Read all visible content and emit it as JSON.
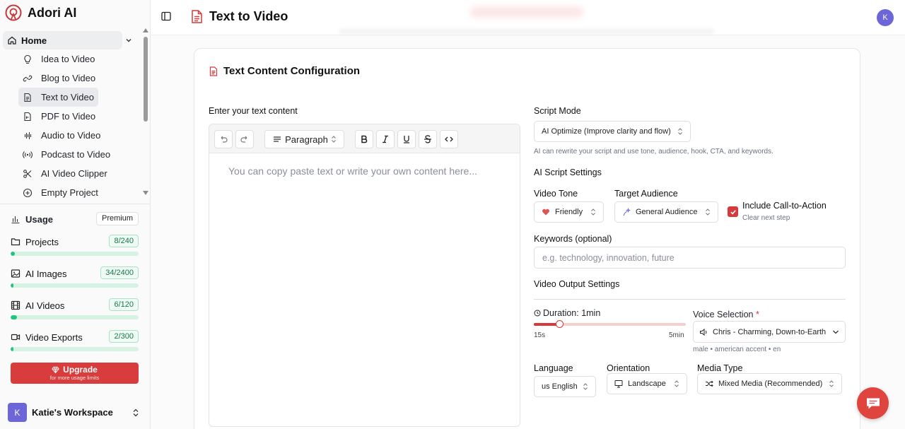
{
  "app": {
    "name": "Adori AI"
  },
  "sidebar": {
    "home_label": "Home",
    "nav_items": [
      {
        "label": "Idea to Video",
        "icon": "lightbulb-icon"
      },
      {
        "label": "Blog to Video",
        "icon": "link-icon"
      },
      {
        "label": "Text to Video",
        "icon": "document-icon",
        "active": true
      },
      {
        "label": "PDF to Video",
        "icon": "pdf-icon"
      },
      {
        "label": "Audio to Video",
        "icon": "audio-wave-icon"
      },
      {
        "label": "Podcast to Video",
        "icon": "podcast-icon"
      },
      {
        "label": "AI Video Clipper",
        "icon": "scissors-icon"
      },
      {
        "label": "Empty Project",
        "icon": "plus-circle-icon"
      }
    ],
    "usage": {
      "label": "Usage",
      "plan": "Premium",
      "items": [
        {
          "label": "Projects",
          "count": "8/240",
          "fraction": 0.033,
          "icon": "folder-icon"
        },
        {
          "label": "AI Images",
          "count": "34/2400",
          "fraction": 0.014,
          "icon": "image-icon"
        },
        {
          "label": "AI Videos",
          "count": "6/120",
          "fraction": 0.05,
          "icon": "film-icon"
        },
        {
          "label": "Video Exports",
          "count": "2/300",
          "fraction": 0.007,
          "icon": "video-camera-icon"
        }
      ]
    },
    "upgrade": {
      "title": "Upgrade",
      "subtitle": "for more usage limits"
    },
    "workspace": {
      "initial": "K",
      "name": "Katie's Workspace"
    }
  },
  "header": {
    "title": "Text to Video",
    "user_initial": "K"
  },
  "card": {
    "title": "Text Content Configuration",
    "editor": {
      "label": "Enter your text content",
      "block_type": "Paragraph",
      "placeholder": "You can copy paste text or write your own content here..."
    },
    "script_mode": {
      "label": "Script Mode",
      "value": "AI Optimize (Improve clarity and flow)",
      "help": "AI can rewrite your script and use tone, audience, hook, CTA, and keywords."
    },
    "ai_script_settings": {
      "heading": "AI Script Settings",
      "tone_label": "Video Tone",
      "tone_value": "Friendly",
      "audience_label": "Target Audience",
      "audience_value": "General Audience",
      "cta_label": "Include Call-to-Action",
      "cta_sub": "Clear next step",
      "cta_checked": true
    },
    "keywords": {
      "label": "Keywords (optional)",
      "placeholder": "e.g. technology, innovation, future"
    },
    "output": {
      "heading": "Video Output Settings",
      "duration_label": "Duration: 1min",
      "duration_min": "15s",
      "duration_max": "5min",
      "duration_fraction": 0.17,
      "voice_label": "Voice Selection",
      "voice_required": "*",
      "voice_value": "Chris - Charming, Down-to-Earth",
      "voice_meta": "male • american accent • en",
      "language_label": "Language",
      "language_value": "us English",
      "orientation_label": "Orientation",
      "orientation_value": "Landscape",
      "media_label": "Media Type",
      "media_value": "Mixed Media (Recommended)"
    }
  },
  "colors": {
    "accent": "#d63a3a",
    "usage_fill": "#22c580",
    "avatar": "#6c66d9"
  }
}
